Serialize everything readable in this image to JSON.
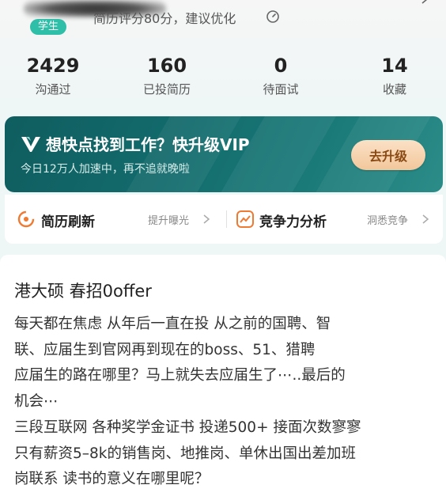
{
  "profile": {
    "badge": "学生",
    "resume_score_text": "简历评分80分，建议优化"
  },
  "stats": [
    {
      "value": "2429",
      "label": "沟通过"
    },
    {
      "value": "160",
      "label": "已投简历"
    },
    {
      "value": "0",
      "label": "待面试"
    },
    {
      "value": "14",
      "label": "收藏"
    }
  ],
  "vip_banner": {
    "title": "想快点找到工作？快升级VIP",
    "subtitle": "今日12万人加速中，再不追就晚啦",
    "button_label": "去升级",
    "colors": {
      "background": "#136b6c",
      "button": "#f2c79b",
      "button_text": "#8a4a14"
    }
  },
  "features": [
    {
      "label": "简历刷新",
      "hint": "提升曝光",
      "icon": "refresh-icon"
    },
    {
      "label": "竞争力分析",
      "hint": "洞悉竞争",
      "icon": "chart-icon"
    }
  ],
  "post": {
    "title": "港大硕 春招0offer",
    "lines": [
      "每天都在焦虑 从年后一直在投 从之前的国聘、智",
      "联、应届生到官网再到现在的boss、51、猎聘",
      "应届生的路在哪里？马上就失去应届生了⋯..最后的",
      "机会⋯",
      "三段互联网 各种奖学金证书 投递500+ 接面次数寥寥",
      "只有薪资5–8k的销售岗、地推岗、单休出国出差加班",
      "岗联系 读书的意义在哪里呢？"
    ]
  },
  "accent_color": "#2fbfa9"
}
